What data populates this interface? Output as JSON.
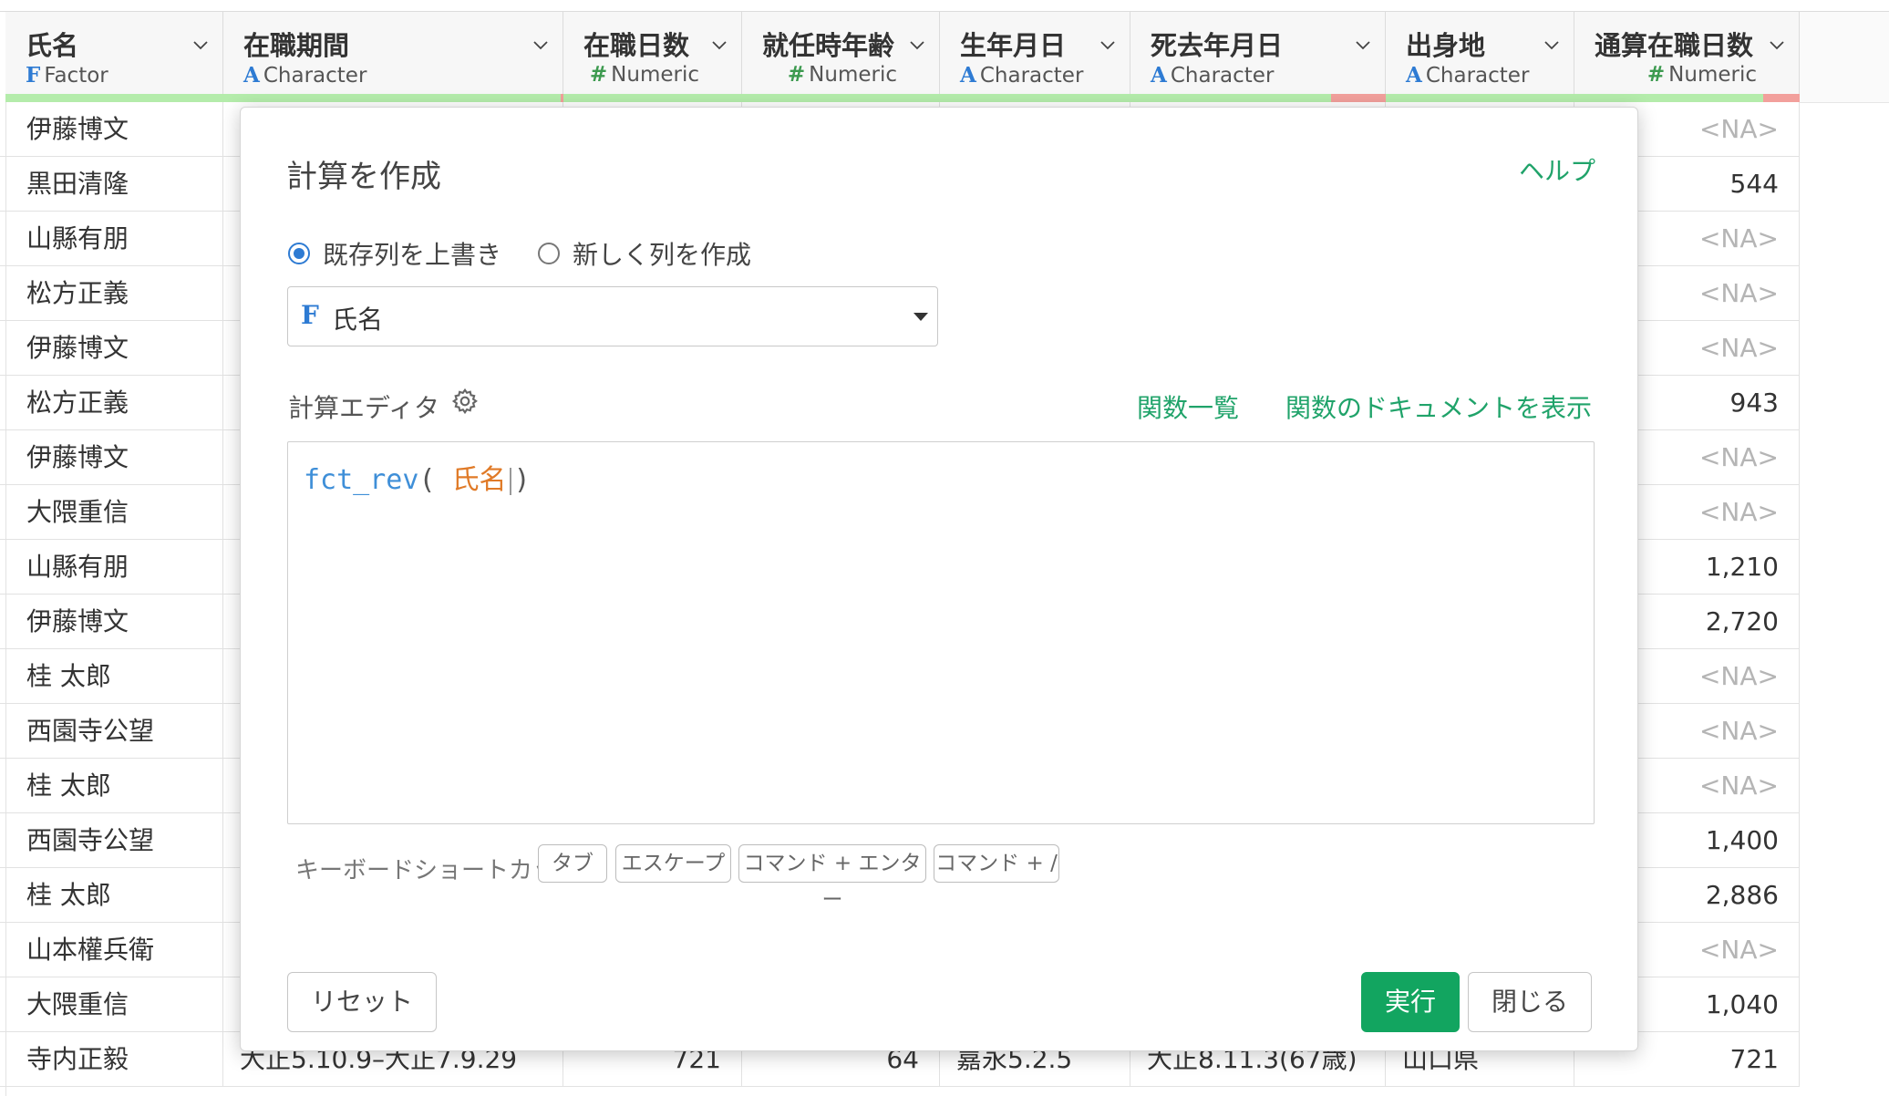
{
  "columns": [
    {
      "name": "氏名",
      "type_glyph": "F",
      "type": "Factor",
      "glyph_class": "F"
    },
    {
      "name": "在職期間",
      "type_glyph": "A",
      "type": "Character",
      "glyph_class": "A"
    },
    {
      "name": "在職日数",
      "type_glyph": "#",
      "type": "Numeric",
      "glyph_class": "N"
    },
    {
      "name": "就任時年齢",
      "type_glyph": "#",
      "type": "Numeric",
      "glyph_class": "N"
    },
    {
      "name": "生年月日",
      "type_glyph": "A",
      "type": "Character",
      "glyph_class": "A"
    },
    {
      "name": "死去年月日",
      "type_glyph": "A",
      "type": "Character",
      "glyph_class": "A"
    },
    {
      "name": "出身地",
      "type_glyph": "A",
      "type": "Character",
      "glyph_class": "A"
    },
    {
      "name": "通算在職日数",
      "type_glyph": "#",
      "type": "Numeric",
      "glyph_class": "N"
    }
  ],
  "rows": [
    {
      "name": "伊藤博文",
      "total": "<NA>"
    },
    {
      "name": "黒田清隆",
      "total": "544"
    },
    {
      "name": "山縣有朋",
      "total": "<NA>"
    },
    {
      "name": "松方正義",
      "total": "<NA>"
    },
    {
      "name": "伊藤博文",
      "total": "<NA>"
    },
    {
      "name": "松方正義",
      "total": "943"
    },
    {
      "name": "伊藤博文",
      "total": "<NA>"
    },
    {
      "name": "大隈重信",
      "total": "<NA>"
    },
    {
      "name": "山縣有朋",
      "total": "1,210"
    },
    {
      "name": "伊藤博文",
      "total": "2,720"
    },
    {
      "name": "桂 太郎",
      "total": "<NA>"
    },
    {
      "name": "西園寺公望",
      "total": "<NA>"
    },
    {
      "name": "桂 太郎",
      "total": "<NA>"
    },
    {
      "name": "西園寺公望",
      "total": "1,400"
    },
    {
      "name": "桂 太郎",
      "total": "2,886"
    },
    {
      "name": "山本權兵衛",
      "total": "<NA>"
    },
    {
      "name": "大隈重信",
      "total": "1,040"
    },
    {
      "name": "寺内正毅",
      "total": "721"
    }
  ],
  "last_row": {
    "period": "大正5.10.9–大正7.9.29",
    "days": "721",
    "age": "64",
    "birth": "嘉永5.2.5",
    "death": "大正8.11.3(67歳)",
    "origin": "山口県"
  },
  "dialog": {
    "title": "計算を作成",
    "help": "ヘルプ",
    "radio_overwrite": "既存列を上書き",
    "radio_new": "新しく列を作成",
    "selected_glyph": "F",
    "selected_column": "氏名",
    "editor_label": "計算エディタ",
    "link_functions": "関数一覧",
    "link_docs": "関数のドキュメントを表示",
    "code_fn": "fct_rev",
    "code_open": "(",
    "code_arg": "氏名",
    "code_close": ")",
    "shortcut_label": "キーボードショートカット:",
    "shortcuts": [
      "タブ",
      "エスケープ",
      "コマンド + エンター",
      "コマンド + /"
    ],
    "reset": "リセット",
    "run": "実行",
    "close": "閉じる"
  }
}
